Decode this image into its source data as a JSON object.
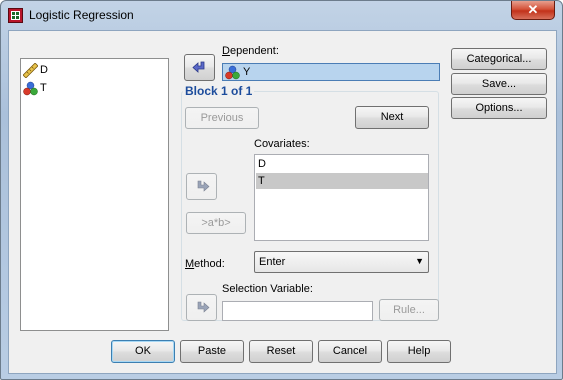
{
  "window": {
    "title": "Logistic Regression",
    "close_glyph": "✕"
  },
  "variables": [
    {
      "name": "D",
      "icon": "ruler-scale-icon"
    },
    {
      "name": "T",
      "icon": "nominal-balls-icon"
    }
  ],
  "dependent": {
    "label": "Dependent:",
    "value": "Y"
  },
  "block": {
    "title": "Block 1 of 1",
    "previous": "Previous",
    "next": "Next"
  },
  "covariates": {
    "label": "Covariates:",
    "items": [
      "D",
      "T"
    ],
    "selected_index": 1
  },
  "interaction_button": ">a*b>",
  "method": {
    "label": "Method:",
    "value": "Enter",
    "arrow": "▼"
  },
  "selection_variable": {
    "label": "Selection Variable:",
    "value": "",
    "rule_button": "Rule..."
  },
  "side_buttons": {
    "categorical": "Categorical...",
    "save": "Save...",
    "options": "Options..."
  },
  "bottom_buttons": {
    "ok": "OK",
    "paste": "Paste",
    "reset": "Reset",
    "cancel": "Cancel",
    "help": "Help"
  }
}
